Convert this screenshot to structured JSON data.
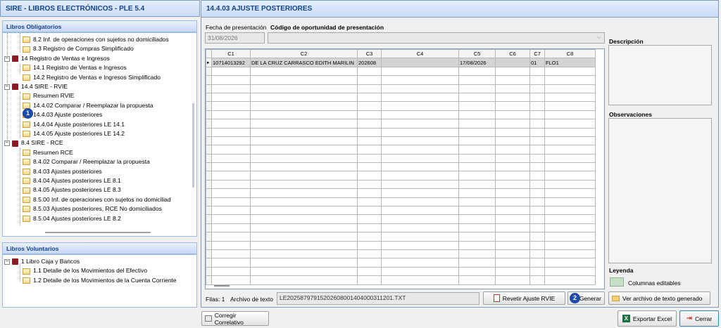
{
  "left_title": "SIRE - LIBROS ELECTRÓNICOS - PLE 5.4",
  "obligatorios": {
    "header": "Libros Obligatorios",
    "rows": [
      {
        "label": "8.2 Inf. de operaciones con sujetos no domiciliados",
        "kind": "doc",
        "level": 2
      },
      {
        "label": "8.3 Registro de Compras Simplificado",
        "kind": "doc",
        "level": 2
      },
      {
        "label": "14 Registro de Ventas e Ingresos",
        "kind": "book",
        "level": 1
      },
      {
        "label": "14.1 Registro de Ventas e Ingresos",
        "kind": "doc",
        "level": 2
      },
      {
        "label": "14.2 Registro de Ventas e Ingresos Simplificado",
        "kind": "doc",
        "level": 2
      },
      {
        "label": "14.4 SIRE - RVIE",
        "kind": "book",
        "level": 1
      },
      {
        "label": "Resumen RVIE",
        "kind": "doc",
        "level": 2
      },
      {
        "label": "14.4.02 Comparar / Reemplazar la propuesta",
        "kind": "doc",
        "level": 2
      },
      {
        "label": "14.4.03 Ajuste posteriores",
        "kind": "doc",
        "level": 2
      },
      {
        "label": "14.4.04 Ajuste posteriores  LE 14.1",
        "kind": "doc",
        "level": 2
      },
      {
        "label": "14.4.05 Ajuste posteriores  LE 14.2",
        "kind": "doc",
        "level": 2
      },
      {
        "label": "8.4 SIRE - RCE",
        "kind": "book",
        "level": 1
      },
      {
        "label": "Resumen RCE",
        "kind": "doc",
        "level": 2
      },
      {
        "label": "8.4.02 Comparar / Reemplazar la propuesta",
        "kind": "doc",
        "level": 2
      },
      {
        "label": "8.4.03 Ajustes posteriores",
        "kind": "doc",
        "level": 2
      },
      {
        "label": "8.4.04 Ajustes posteriores LE 8.1",
        "kind": "doc",
        "level": 2
      },
      {
        "label": "8.4.05 Ajustes posteriores LE 8.3",
        "kind": "doc",
        "level": 2
      },
      {
        "label": "8.5.00 Inf. de operaciones con sujetos no domiciliad",
        "kind": "doc",
        "level": 2
      },
      {
        "label": "8.5.03 Ajustes posteriores, RCE No domiciliados",
        "kind": "doc",
        "level": 2
      },
      {
        "label": "8.5.04 Ajustes posteriores LE 8.2",
        "kind": "doc",
        "level": 2
      }
    ]
  },
  "voluntarios": {
    "header": "Libros Voluntarios",
    "rows": [
      {
        "label": "1 Libro Caja y Bancos",
        "kind": "book",
        "level": 1
      },
      {
        "label": "1.1 Detalle de los Movimientos del Efectivo",
        "kind": "doc",
        "level": 2
      },
      {
        "label": "1.2 Detalle de los Movimientos de la Cuenta Corriente",
        "kind": "doc",
        "level": 2
      }
    ]
  },
  "badges": {
    "one": "1",
    "two": "2"
  },
  "right_title": "14.4.03 AJUSTE POSTERIORES",
  "fecha_label": "Fecha de presentación",
  "codigo_label": "Código de oportunidad de presentación",
  "fecha_value": "31/08/2026",
  "grid": {
    "columns": [
      "C1",
      "C2",
      "C3",
      "C4",
      "C5",
      "C6",
      "C7",
      "C8"
    ],
    "row": [
      "10714013292",
      "DE LA CRUZ CARRASCO EDITH MARILIN",
      "202608",
      "",
      "17/08/2026",
      "",
      "01",
      "FLO1"
    ]
  },
  "descripcion_label": "Descripción",
  "observaciones_label": "Observaciones",
  "leyenda_label": "Leyenda",
  "columnas_editables": "Columnas editables",
  "filas_label": "Filas: 1",
  "archivo_label": "Archivo de texto",
  "archivo_value": "LE20258797915202608001404000311201.TXT",
  "revertir_label": "Revetir Ajuste RVIE",
  "generar_label": "Generar",
  "ver_archivo_label": "Ver archivo de texto generado",
  "corregir_label": "Corregir Correlativo",
  "exportar_label": "Exportar Excel",
  "cerrar_label": "Cerrar",
  "colors": {
    "accent": "#1e4ba8",
    "header_text": "#15428b",
    "legend_green": "#c6e0c6"
  }
}
